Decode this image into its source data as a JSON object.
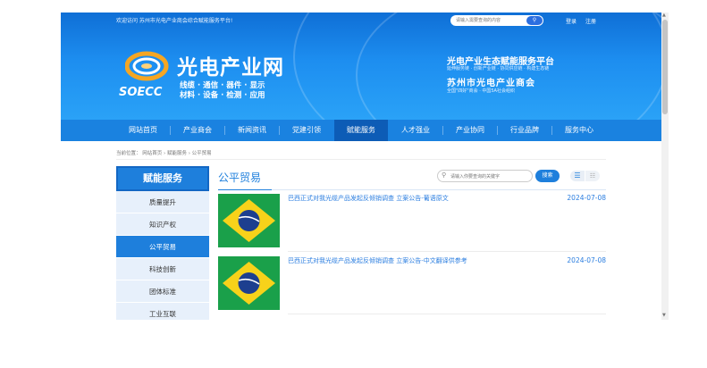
{
  "topbar": {
    "welcome": "欢迎访问 苏州市光电产业商会综合赋能服务平台!",
    "search_placeholder": "请输入需要查询的内容",
    "search_icon": "search-icon",
    "login": "登录",
    "register": "注册"
  },
  "brand": {
    "logo_en": "SOECC",
    "name_cn": "光电产业网",
    "tagline1": "线缆 · 通信 · 器件 · 显示",
    "tagline2": "材料 · 设备 · 检测 · 应用",
    "platform": "光电产业生态赋能服务平台",
    "platform_sub": "延伸服务链 · 创新产业链 · 协同供应链 · 构建生态链",
    "chamber": "苏州市光电产业商会",
    "chamber_sub": "全国\"四好\"商会 · 中国5A社会组织"
  },
  "nav": [
    "网站首页",
    "产业商会",
    "新闻资讯",
    "党建引领",
    "赋能服务",
    "人才强业",
    "产业协同",
    "行业品牌",
    "服务中心"
  ],
  "nav_active": 4,
  "breadcrumb": "当前位置： 网站首页 › 赋能服务 › 公平贸易",
  "sidebar": {
    "title": "赋能服务",
    "items": [
      "质量提升",
      "知识产权",
      "公平贸易",
      "科技创新",
      "团体标准",
      "工业互联"
    ],
    "active": 2
  },
  "main": {
    "title": "公平贸易",
    "search_placeholder": "请输入你要查询的关键字",
    "search_button": "搜索",
    "list_view_icon": "list-view-icon",
    "grid_view_icon": "grid-view-icon",
    "articles": [
      {
        "title": "巴西正式对我光缆产品发起反倾销调查 立案公告-葡语原文",
        "date": "2024-07-08",
        "thumb": "brazil-flag"
      },
      {
        "title": "巴西正式对我光缆产品发起反倾销调查 立案公告-中文翻译供参考",
        "date": "2024-07-08",
        "thumb": "brazil-flag"
      }
    ]
  },
  "colors": {
    "primary": "#1e7fdc",
    "nav": "#1a82e0",
    "nav_active": "#0d5cb6",
    "link": "#2b7ee0"
  }
}
